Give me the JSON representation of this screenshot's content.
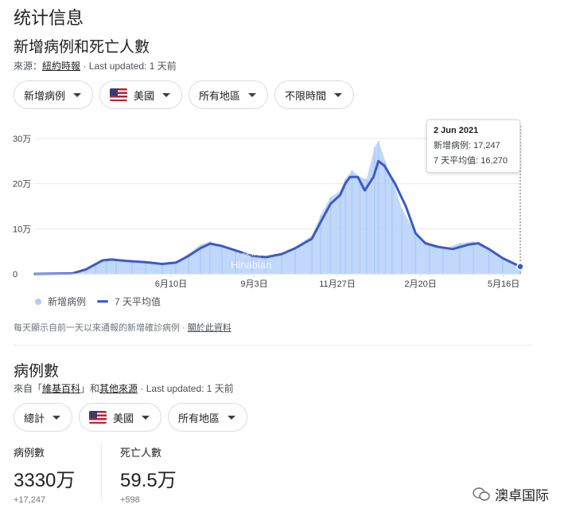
{
  "page": {
    "title": "统计信息"
  },
  "cases_section": {
    "title": "新增病例和死亡人數",
    "source_prefix": "來源：",
    "source_link": "紐約時報",
    "updated": " · Last updated: 1 天前",
    "chips": [
      {
        "label": "新增病例"
      },
      {
        "label": "美國",
        "icon": "us-flag-icon"
      },
      {
        "label": "所有地區"
      },
      {
        "label": "不限時間"
      }
    ]
  },
  "chart_data": {
    "type": "bar",
    "y_tick_labels": [
      "0",
      "10万",
      "20万",
      "30万"
    ],
    "ylim": [
      0,
      300000
    ],
    "x_tick_labels": [
      "6月10日",
      "9月3日",
      "11月27日",
      "2月20日",
      "5月16日"
    ],
    "grid": true,
    "legend": {
      "position": "bottom-left",
      "items": [
        "新增病例",
        "7 天平均值"
      ]
    },
    "series": [
      {
        "name": "新增病例",
        "type": "bar",
        "color": "#aecbfa",
        "x": [
          "2020-01-23",
          "2020-02-15",
          "2020-03-01",
          "2020-03-15",
          "2020-03-25",
          "2020-04-05",
          "2020-04-15",
          "2020-05-01",
          "2020-05-15",
          "2020-06-01",
          "2020-06-15",
          "2020-06-28",
          "2020-07-10",
          "2020-07-20",
          "2020-08-01",
          "2020-08-15",
          "2020-09-01",
          "2020-09-15",
          "2020-10-01",
          "2020-10-15",
          "2020-11-01",
          "2020-11-10",
          "2020-11-20",
          "2020-11-30",
          "2020-12-05",
          "2020-12-12",
          "2020-12-20",
          "2020-12-27",
          "2021-01-04",
          "2021-01-08",
          "2021-01-15",
          "2021-01-22",
          "2021-02-01",
          "2021-02-15",
          "2021-03-01",
          "2021-03-15",
          "2021-04-01",
          "2021-04-15",
          "2021-05-01",
          "2021-05-15",
          "2021-06-02"
        ],
        "values": [
          0,
          0,
          1000,
          12000,
          22000,
          33000,
          32000,
          30000,
          26000,
          22000,
          25000,
          45000,
          65000,
          72000,
          62000,
          55000,
          42000,
          40000,
          46000,
          60000,
          85000,
          130000,
          170000,
          185000,
          210000,
          230000,
          215000,
          210000,
          280000,
          295000,
          250000,
          210000,
          145000,
          90000,
          65000,
          55000,
          68000,
          72000,
          55000,
          35000,
          17247
        ]
      },
      {
        "name": "7 天平均值",
        "type": "line",
        "color": "#3b5bc9",
        "x": [
          "2020-01-23",
          "2020-03-01",
          "2020-03-15",
          "2020-04-01",
          "2020-04-10",
          "2020-04-25",
          "2020-05-15",
          "2020-06-01",
          "2020-06-15",
          "2020-06-28",
          "2020-07-10",
          "2020-07-20",
          "2020-08-01",
          "2020-08-15",
          "2020-09-01",
          "2020-09-15",
          "2020-10-01",
          "2020-10-15",
          "2020-11-01",
          "2020-11-10",
          "2020-11-20",
          "2020-11-30",
          "2020-12-05",
          "2020-12-10",
          "2020-12-18",
          "2020-12-25",
          "2021-01-03",
          "2021-01-08",
          "2021-01-14",
          "2021-01-25",
          "2021-02-05",
          "2021-02-15",
          "2021-02-25",
          "2021-03-10",
          "2021-03-25",
          "2021-04-10",
          "2021-04-20",
          "2021-05-01",
          "2021-05-15",
          "2021-06-02"
        ],
        "values": [
          0,
          1000,
          10000,
          30000,
          32000,
          29000,
          26000,
          22000,
          25000,
          40000,
          57000,
          67000,
          62000,
          52000,
          40000,
          37000,
          44000,
          57000,
          78000,
          115000,
          155000,
          175000,
          200000,
          215000,
          215000,
          185000,
          215000,
          250000,
          240000,
          200000,
          150000,
          90000,
          68000,
          60000,
          55000,
          65000,
          68000,
          55000,
          35000,
          16270
        ]
      }
    ]
  },
  "tooltip": {
    "date": "2 Jun 2021",
    "cases": "新增病例: 17,247",
    "average": "7 天平均值: 16,270"
  },
  "cases_footnote": {
    "text": "每天顯示自前一天以來通報的新增確診病例 · ",
    "link": "關於此資料"
  },
  "watermark": {
    "line1": "澳洲",
    "line2": "Hinabian"
  },
  "totals_section": {
    "title": "病例數",
    "source_prefix": "來自「",
    "source_link1": "維基百科",
    "source_mid": "」和",
    "source_link2": "其他來源",
    "updated": " · Last updated: 1 天前",
    "chips": [
      {
        "label": "總計"
      },
      {
        "label": "美國",
        "icon": "us-flag-icon"
      },
      {
        "label": "所有地區"
      }
    ],
    "stats": [
      {
        "label": "病例數",
        "value": "3330万",
        "delta": "+17,247"
      },
      {
        "label": "死亡人數",
        "value": "59.5万",
        "delta": "+598"
      }
    ]
  },
  "brand": {
    "name": "澳卓国际"
  }
}
